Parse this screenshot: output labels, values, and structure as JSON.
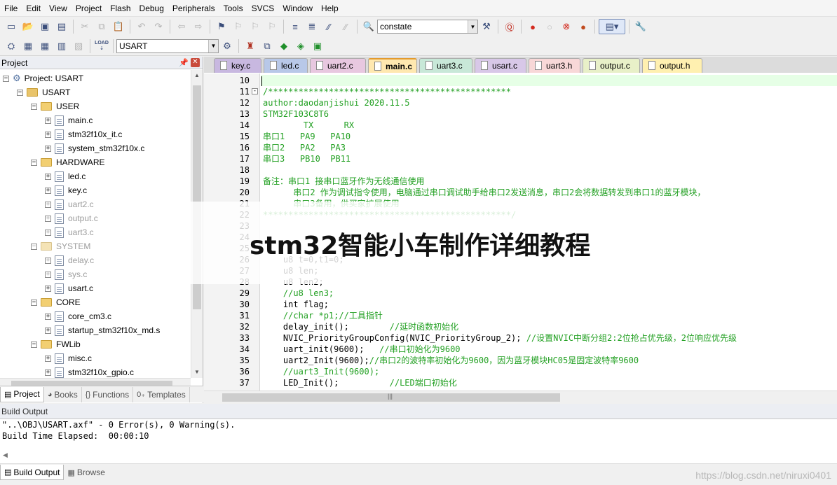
{
  "menu": [
    "File",
    "Edit",
    "View",
    "Project",
    "Flash",
    "Debug",
    "Peripherals",
    "Tools",
    "SVCS",
    "Window",
    "Help"
  ],
  "toolbar": {
    "find_value": "constate",
    "target_value": "USART",
    "load_label": "LOAD"
  },
  "project": {
    "header": "Project",
    "root": "Project: USART",
    "target": "USART",
    "groups": [
      {
        "name": "USER",
        "dim": false,
        "files": [
          {
            "name": "main.c",
            "dim": false
          },
          {
            "name": "stm32f10x_it.c",
            "dim": false
          },
          {
            "name": "system_stm32f10x.c",
            "dim": false
          }
        ]
      },
      {
        "name": "HARDWARE",
        "dim": false,
        "files": [
          {
            "name": "led.c",
            "dim": false
          },
          {
            "name": "key.c",
            "dim": false
          },
          {
            "name": "uart2.c",
            "dim": true
          },
          {
            "name": "output.c",
            "dim": true
          },
          {
            "name": "uart3.c",
            "dim": true
          }
        ]
      },
      {
        "name": "SYSTEM",
        "dim": true,
        "files": [
          {
            "name": "delay.c",
            "dim": true
          },
          {
            "name": "sys.c",
            "dim": true
          },
          {
            "name": "usart.c",
            "dim": false
          }
        ]
      },
      {
        "name": "CORE",
        "dim": false,
        "files": [
          {
            "name": "core_cm3.c",
            "dim": false
          },
          {
            "name": "startup_stm32f10x_md.s",
            "dim": false
          }
        ]
      },
      {
        "name": "FWLib",
        "dim": false,
        "files": [
          {
            "name": "misc.c",
            "dim": false
          },
          {
            "name": "stm32f10x_gpio.c",
            "dim": false
          }
        ]
      }
    ],
    "tabs": [
      "Project",
      "Books",
      "Functions",
      "Templates"
    ]
  },
  "editor": {
    "tabs": [
      {
        "name": "key.c",
        "color": "#c8b8e0"
      },
      {
        "name": "led.c",
        "color": "#b8c8e8"
      },
      {
        "name": "uart2.c",
        "color": "#e8c8e0"
      },
      {
        "name": "main.c",
        "color": "#ffe8b0"
      },
      {
        "name": "uart3.c",
        "color": "#c8e8d8"
      },
      {
        "name": "usart.c",
        "color": "#d8c8e8"
      },
      {
        "name": "uart3.h",
        "color": "#f8d8d8"
      },
      {
        "name": "output.c",
        "color": "#e8f0c8"
      },
      {
        "name": "output.h",
        "color": "#fff0b0"
      }
    ],
    "active_tab": "main.c",
    "lines": [
      {
        "n": "10",
        "t": "",
        "k": "hl"
      },
      {
        "n": "11",
        "t": "/************************************************",
        "k": "cm",
        "fold": "-"
      },
      {
        "n": "12",
        "t": "author:daodanjishui 2020.11.5",
        "k": "cm"
      },
      {
        "n": "13",
        "t": "STM32F103C8T6",
        "k": "cm"
      },
      {
        "n": "14",
        "t": "        TX      RX",
        "k": "cm"
      },
      {
        "n": "15",
        "t": "串口1   PA9   PA10",
        "k": "cm"
      },
      {
        "n": "16",
        "t": "串口2   PA2   PA3",
        "k": "cm"
      },
      {
        "n": "17",
        "t": "串口3   PB10  PB11",
        "k": "cm"
      },
      {
        "n": "18",
        "t": "",
        "k": "cm"
      },
      {
        "n": "19",
        "t": "备注：串口1 接串口蓝牙作为无线通信使用",
        "k": "cm"
      },
      {
        "n": "20",
        "t": "      串口2 作为调试指令使用，电脑通过串口调试助手给串口2发送消息，串口2会将数据转发到串口1的蓝牙模块，",
        "k": "cm"
      },
      {
        "n": "21",
        "t": "      串口3备用，供买家扩展使用",
        "k": "cm"
      },
      {
        "n": "22",
        "t": "*************************************************/",
        "k": "cm"
      },
      {
        "n": "23",
        "t": "",
        "k": "cd"
      },
      {
        "n": "24",
        "t": "",
        "k": "cd"
      },
      {
        "n": "25",
        "t": "",
        "k": "cd"
      },
      {
        "n": "26",
        "t": "    u8 t=0,t1=0;",
        "k": "cd"
      },
      {
        "n": "27",
        "t": "    u8 len;",
        "k": "cd"
      },
      {
        "n": "28",
        "t": "    u8 len2;",
        "k": "cd"
      },
      {
        "n": "29",
        "t": "    //u8 len3;",
        "k": "cm"
      },
      {
        "n": "30",
        "t": "    int flag;",
        "k": "cd"
      },
      {
        "n": "31",
        "t": "    //char *p1;//工具指针",
        "k": "cm"
      },
      {
        "n": "32",
        "t": "    delay_init();",
        "c": "        //延时函数初始化",
        "k": "cd"
      },
      {
        "n": "33",
        "t": "    NVIC_PriorityGroupConfig(NVIC_PriorityGroup_2);",
        "c": " //设置NVIC中断分组2:2位抢占优先级，2位响应优先级",
        "k": "cd"
      },
      {
        "n": "34",
        "t": "    uart_init(9600);",
        "c": "   //串口初始化为9600",
        "k": "cd"
      },
      {
        "n": "35",
        "t": "    uart2_Init(9600);",
        "c": "//串口2的波特率初始化为9600，因为蓝牙模块HC05是固定波特率9600",
        "k": "cd"
      },
      {
        "n": "36",
        "t": "    //uart3_Init(9600);",
        "k": "cm"
      },
      {
        "n": "37",
        "t": "    LED_Init();",
        "c": "          //LED端口初始化",
        "k": "cd"
      }
    ]
  },
  "build": {
    "header": "Build Output",
    "lines": [
      "\"..\\OBJ\\USART.axf\" - 0 Error(s), 0 Warning(s).",
      "Build Time Elapsed:  00:00:10"
    ],
    "tabs": [
      "Build Output",
      "Browse"
    ]
  },
  "overlay_title": "stm32智能小车制作详细教程",
  "watermark": "https://blog.csdn.net/niruxi0401"
}
